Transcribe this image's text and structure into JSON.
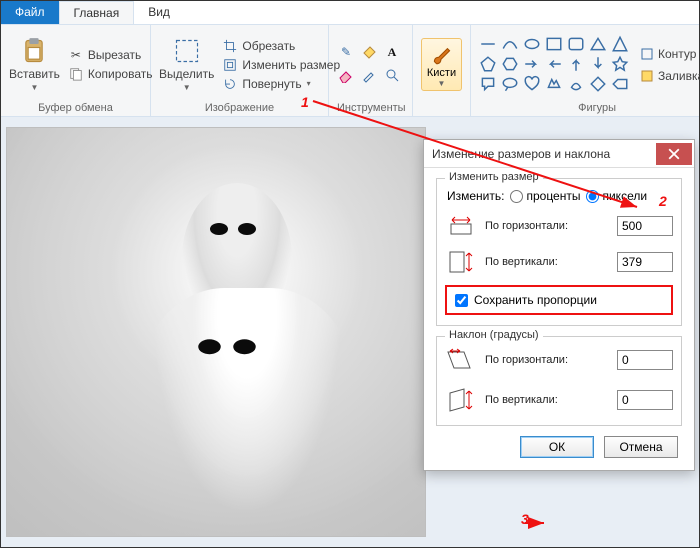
{
  "tabs": {
    "file": "Файл",
    "home": "Главная",
    "view": "Вид"
  },
  "ribbon": {
    "clipboard": {
      "title": "Буфер обмена",
      "paste": "Вставить",
      "cut": "Вырезать",
      "copy": "Копировать"
    },
    "image": {
      "title": "Изображение",
      "select": "Выделить",
      "crop": "Обрезать",
      "resize": "Изменить размер",
      "rotate": "Повернуть"
    },
    "tools": {
      "title": "Инструменты"
    },
    "brushes": {
      "title": "Кисти"
    },
    "shapes": {
      "title": "Фигуры",
      "outline": "Контур",
      "fill": "Заливка"
    }
  },
  "dialog": {
    "title": "Изменение размеров и наклона",
    "resize_group": "Изменить размер",
    "by_label": "Изменить:",
    "percent": "проценты",
    "pixels": "пиксели",
    "horizontal": "По горизонтали:",
    "vertical": "По вертикали:",
    "h_value": "500",
    "v_value": "379",
    "keep_ratio": "Сохранить пропорции",
    "skew_group": "Наклон (градусы)",
    "skew_h": "0",
    "skew_v": "0",
    "ok": "ОК",
    "cancel": "Отмена"
  },
  "ann": {
    "n1": "1",
    "n2": "2",
    "n3": "3"
  }
}
